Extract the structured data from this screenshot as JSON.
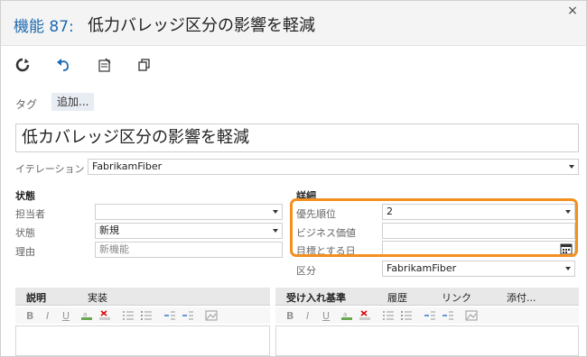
{
  "dialog": {
    "type_label": "機能 87:",
    "title": "低力バレッジ区分の影響を軽減",
    "close_label": "×"
  },
  "toolbar": {
    "icons": [
      "refresh-icon",
      "undo-icon",
      "history-icon",
      "copy-icon"
    ]
  },
  "tags": {
    "label": "タグ",
    "add_label": "追加..."
  },
  "work_item": {
    "title": "低カバレッジ区分の影響を軽減"
  },
  "iteration": {
    "label": "イテレーション",
    "value": "FabrikamFiber"
  },
  "status_section": {
    "heading": "状態",
    "assigned_label": "担当者",
    "assigned_value": "",
    "state_label": "状態",
    "state_value": "新規",
    "reason_label": "理由",
    "reason_value": "新機能"
  },
  "details_section": {
    "heading": "詳細",
    "priority_label": "優先順位",
    "priority_value": "2",
    "business_value_label": "ビジネス価値",
    "business_value_value": "",
    "target_date_label": "目標とする日",
    "target_date_value": "",
    "area_label": "区分",
    "area_value": "FabrikamFiber"
  },
  "left_tabs": [
    "説明",
    "実装"
  ],
  "right_tabs": [
    "受け入れ基準",
    "履歴",
    "リンク",
    "添付..."
  ],
  "editor_buttons": [
    "B",
    "I",
    "U"
  ],
  "colors": {
    "accent": "#1e6ab0",
    "highlight": "#f39020"
  }
}
